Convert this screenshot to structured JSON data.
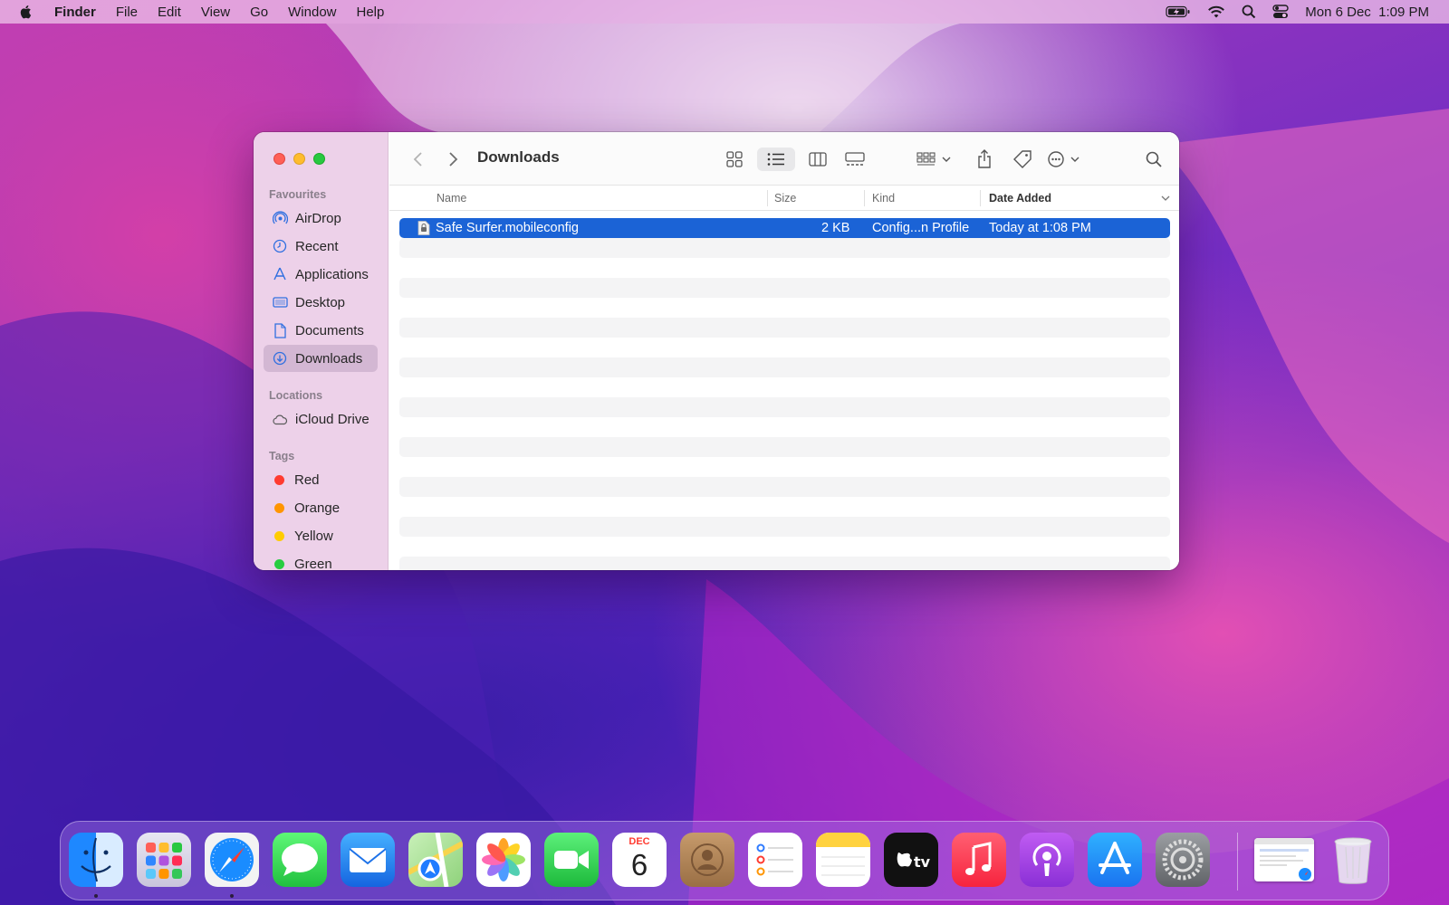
{
  "menubar": {
    "app_name": "Finder",
    "menus": [
      "File",
      "Edit",
      "View",
      "Go",
      "Window",
      "Help"
    ],
    "datetime": "Mon 6 Dec  1:09 PM",
    "status_icons": [
      "battery-charging-icon",
      "wifi-icon",
      "spotlight-search-icon",
      "control-center-icon"
    ]
  },
  "finder": {
    "title": "Downloads",
    "sidebar": {
      "favourites_label": "Favourites",
      "favourites": [
        {
          "label": "AirDrop",
          "icon": "airdrop-icon"
        },
        {
          "label": "Recent",
          "icon": "clock-icon"
        },
        {
          "label": "Applications",
          "icon": "applications-icon"
        },
        {
          "label": "Desktop",
          "icon": "desktop-icon"
        },
        {
          "label": "Documents",
          "icon": "document-icon"
        },
        {
          "label": "Downloads",
          "icon": "download-icon"
        }
      ],
      "selected": "Downloads",
      "locations_label": "Locations",
      "locations": [
        {
          "label": "iCloud Drive",
          "icon": "cloud-icon"
        }
      ],
      "tags_label": "Tags",
      "tags": [
        {
          "label": "Red",
          "color": "#ff3b30"
        },
        {
          "label": "Orange",
          "color": "#ff9500"
        },
        {
          "label": "Yellow",
          "color": "#ffcc00"
        },
        {
          "label": "Green",
          "color": "#28cd41"
        }
      ]
    },
    "columns": {
      "name": "Name",
      "size": "Size",
      "kind": "Kind",
      "date_added": "Date Added"
    },
    "files": [
      {
        "name": "Safe Surfer.mobileconfig",
        "size": "2 KB",
        "kind": "Config...n Profile",
        "date_added": "Today at 1:08 PM"
      }
    ]
  },
  "dock": {
    "apps": [
      "Finder",
      "Launchpad",
      "Safari",
      "Messages",
      "Mail",
      "Maps",
      "Photos",
      "FaceTime",
      "Calendar",
      "Contacts",
      "Reminders",
      "Notes",
      "TV",
      "Music",
      "Podcasts",
      "App Store",
      "System Preferences"
    ],
    "running": [
      "Finder",
      "Safari"
    ],
    "calendar": {
      "month": "DEC",
      "day": "6"
    },
    "extras": [
      "Safari window preview",
      "Trash"
    ]
  },
  "colors": {
    "selection": "#1b63d6",
    "accent": "#0a64e4"
  }
}
